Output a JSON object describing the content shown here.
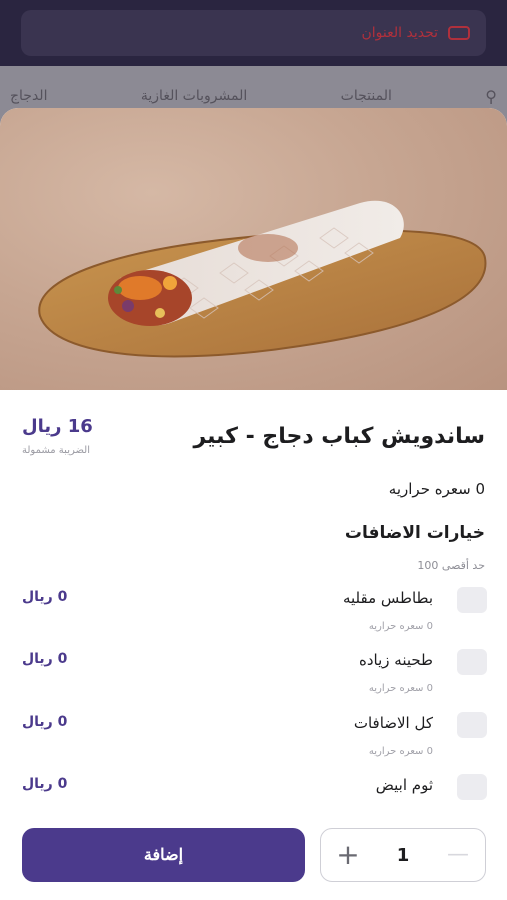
{
  "background": {
    "address_label": "تحديد العنوان",
    "nav": [
      "البحث",
      "المنتجات",
      "المشروبات الغازية",
      "الدجاج"
    ]
  },
  "product": {
    "title": "ساندويش كباب دجاج - كبير",
    "price": "16 ريال",
    "tax_note": "الضريبة مشمولة",
    "calories": "0 سعره حراريه"
  },
  "addons": {
    "section_title": "خيارات الاضافات",
    "max_limit": "حد أقصى 100",
    "items": [
      {
        "name": "بطاطس مقليه",
        "calories": "0 سعره حراريه",
        "price": "0 ريال"
      },
      {
        "name": "طحينه زياده",
        "calories": "0 سعره حراريه",
        "price": "0 ريال"
      },
      {
        "name": "كل الاضافات",
        "calories": "0 سعره حراريه",
        "price": "0 ريال"
      },
      {
        "name": "ثوم ابيض",
        "calories": "",
        "price": "0 ريال"
      }
    ]
  },
  "footer": {
    "add_label": "إضافة",
    "quantity": "1",
    "plus": "+",
    "minus": "—"
  },
  "colors": {
    "accent": "#4b3a8c",
    "checkbox": "#ececf0"
  },
  "icons": [
    "location-icon",
    "search-icon",
    "plus-icon",
    "minus-icon"
  ]
}
